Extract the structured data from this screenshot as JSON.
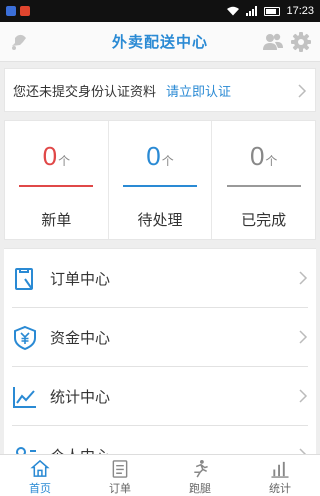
{
  "status_bar": {
    "time": "17:23"
  },
  "header": {
    "title": "外卖配送中心"
  },
  "verify": {
    "message": "您还未提交身份认证资料",
    "link": "请立即认证"
  },
  "stats": [
    {
      "value": "0",
      "unit": "个",
      "label": "新单",
      "color": "#e04848"
    },
    {
      "value": "0",
      "unit": "个",
      "label": "待处理",
      "color": "#2a8ad4"
    },
    {
      "value": "0",
      "unit": "个",
      "label": "已完成",
      "color": "#888888"
    }
  ],
  "menu": [
    {
      "label": "订单中心",
      "icon": "clipboard-icon"
    },
    {
      "label": "资金中心",
      "icon": "shield-yuan-icon"
    },
    {
      "label": "统计中心",
      "icon": "line-chart-icon"
    },
    {
      "label": "个人中心",
      "icon": "person-card-icon"
    }
  ],
  "bottom_nav": [
    {
      "label": "首页",
      "icon": "home-icon",
      "active": true
    },
    {
      "label": "订单",
      "icon": "list-icon",
      "active": false
    },
    {
      "label": "跑腿",
      "icon": "runner-icon",
      "active": false
    },
    {
      "label": "统计",
      "icon": "bar-chart-icon",
      "active": false
    }
  ],
  "colors": {
    "accent": "#2a8ad4",
    "new": "#e04848",
    "done": "#888888"
  }
}
